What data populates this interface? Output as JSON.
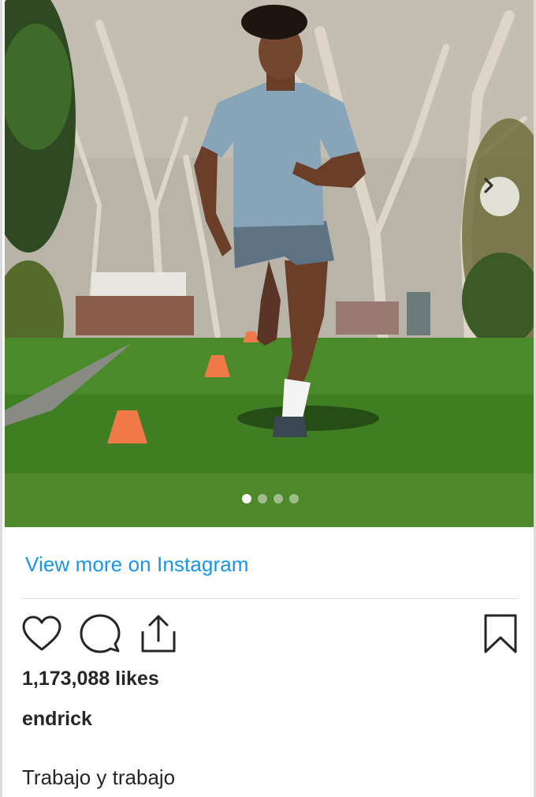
{
  "post": {
    "photo_alt": "Athlete running on grass past orange training cones",
    "carousel": {
      "total_slides": 4,
      "active_index": 0
    }
  },
  "footer": {
    "view_more_link": "View more on Instagram",
    "likes": "1,173,088 likes",
    "username": "endrick",
    "caption": "Trabajo y trabajo"
  },
  "icons": {
    "next": "chevron-right-icon",
    "like": "heart-icon",
    "comment": "comment-bubble-icon",
    "share": "share-icon",
    "save": "bookmark-icon"
  },
  "colors": {
    "link": "#1795e8",
    "text": "#262626",
    "divider": "#dbdbdb"
  }
}
